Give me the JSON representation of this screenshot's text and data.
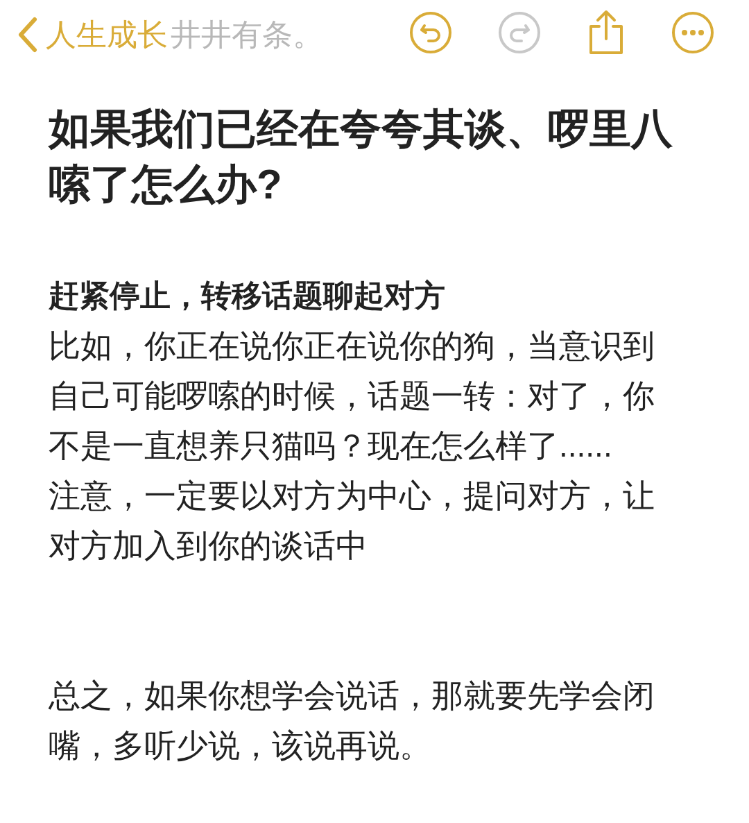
{
  "nav": {
    "back_label": "人生成长",
    "faded_text": "井井有条。",
    "undo": {
      "disabled": false
    },
    "redo": {
      "disabled": true
    }
  },
  "note": {
    "title": "如果我们已经在夸夸其谈、啰里八嗦了怎么办?",
    "blocks": [
      {
        "kind": "heading",
        "text": "赶紧停止，转移话题聊起对方"
      },
      {
        "kind": "paragraph",
        "text": "比如，你正在说你正在说你的狗，当意识到自己可能啰嗦的时候，话题一转：对了，你不是一直想养只猫吗？现在怎么样了......"
      },
      {
        "kind": "paragraph",
        "text": "注意，一定要以对方为中心，提问对方，让对方加入到你的谈话中"
      },
      {
        "kind": "spacer"
      },
      {
        "kind": "paragraph",
        "text": "总之，如果你想学会说话，那就要先学会闭嘴，多听少说，该说再说。"
      }
    ]
  }
}
